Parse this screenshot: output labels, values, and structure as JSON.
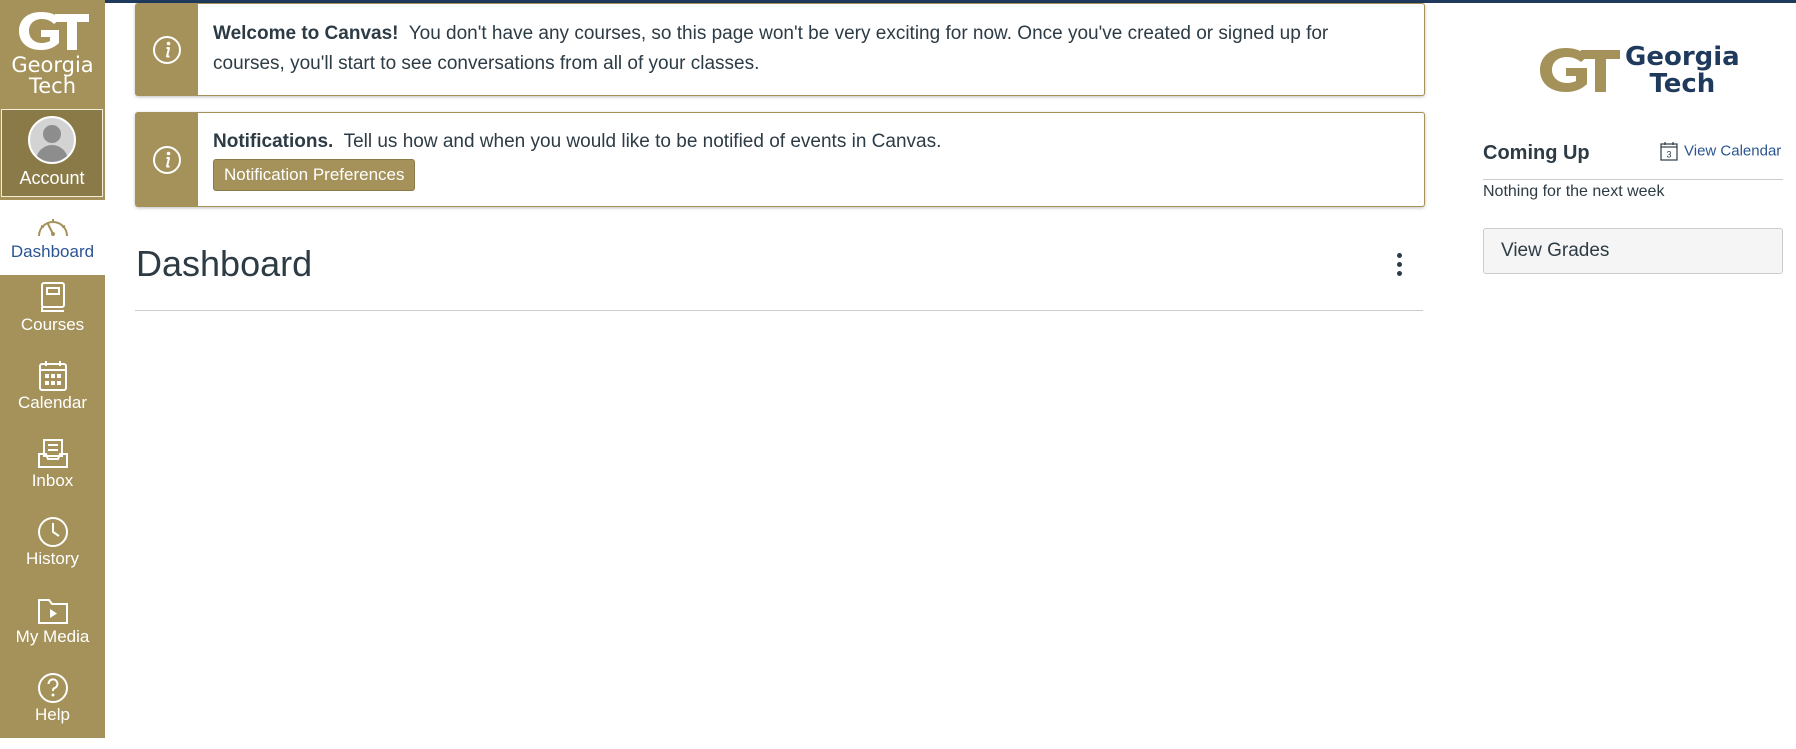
{
  "nav": {
    "logo_line1": "Georgia",
    "logo_line2": "Tech",
    "account": "Account",
    "dashboard": "Dashboard",
    "courses": "Courses",
    "calendar": "Calendar",
    "inbox": "Inbox",
    "history": "History",
    "my_media": "My Media",
    "help": "Help"
  },
  "alerts": {
    "welcome": {
      "title": "Welcome to Canvas!",
      "text": "You don't have any courses, so this page won't be very exciting for now. Once you've created or signed up for courses, you'll start to see conversations from all of your classes."
    },
    "notifications": {
      "title": "Notifications.",
      "text": "Tell us how and when you would like to be notified of events in Canvas.",
      "button": "Notification Preferences"
    }
  },
  "main": {
    "title": "Dashboard"
  },
  "sidebar": {
    "brand_line1": "Georgia",
    "brand_line2": "Tech",
    "coming_up": "Coming Up",
    "calendar_icon_number": "3",
    "view_calendar": "View Calendar",
    "nothing": "Nothing for the next week",
    "view_grades": "View Grades"
  },
  "colors": {
    "gold": "#a4925a",
    "navy": "#1f3a5c",
    "link": "#2a5592",
    "text": "#2d3b45"
  }
}
